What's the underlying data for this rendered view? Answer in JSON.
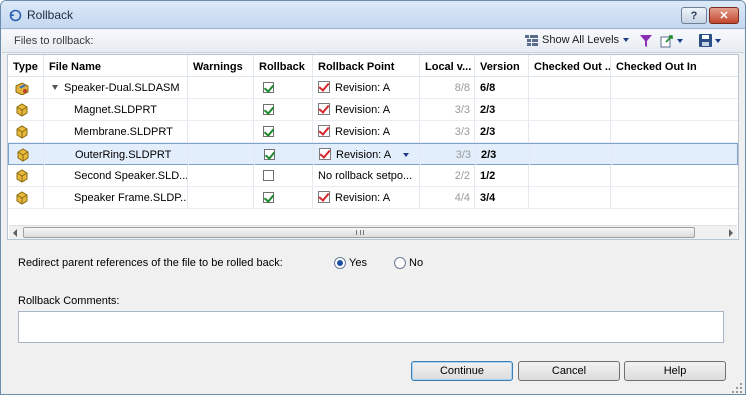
{
  "window": {
    "title": "Rollback",
    "help_label": "?",
    "close_label": "✕"
  },
  "toolbar": {
    "files_label": "Files to rollback:",
    "show_levels_label": "Show All Levels",
    "icons": [
      "filter-icon",
      "export-icon",
      "save-icon"
    ]
  },
  "grid": {
    "columns": [
      "Type",
      "File Name",
      "Warnings",
      "Rollback",
      "Rollback Point",
      "Local v...",
      "Version",
      "Checked Out ...",
      "Checked Out In"
    ],
    "rows": [
      {
        "name": "Speaker-Dual.SLDASM",
        "type": "assembly",
        "rollback": true,
        "rollback_point": "Revision: A",
        "has_revision": true,
        "local": "8/8",
        "version": "6/8",
        "expandable": true
      },
      {
        "name": "Magnet.SLDPRT",
        "type": "part",
        "rollback": true,
        "rollback_point": "Revision: A",
        "has_revision": true,
        "local": "3/3",
        "version": "2/3"
      },
      {
        "name": "Membrane.SLDPRT",
        "type": "part",
        "rollback": true,
        "rollback_point": "Revision: A",
        "has_revision": true,
        "local": "3/3",
        "version": "2/3"
      },
      {
        "name": "OuterRing.SLDPRT",
        "type": "part",
        "rollback": true,
        "rollback_point": "Revision: A",
        "has_revision": true,
        "local": "3/3",
        "version": "2/3",
        "selected": true
      },
      {
        "name": "Second Speaker.SLD...",
        "type": "part",
        "rollback": false,
        "rollback_point": "No rollback setpo...",
        "has_revision": false,
        "local": "2/2",
        "version": "1/2"
      },
      {
        "name": "Speaker Frame.SLDP...",
        "type": "part",
        "rollback": true,
        "rollback_point": "Revision: A",
        "has_revision": true,
        "local": "4/4",
        "version": "3/4"
      }
    ]
  },
  "redirect": {
    "label": "Redirect parent references of the file to be rolled back:",
    "yes": "Yes",
    "no": "No",
    "selected": "Yes"
  },
  "comments": {
    "label": "Rollback Comments:",
    "value": ""
  },
  "buttons": {
    "continue": "Continue",
    "cancel": "Cancel",
    "help": "Help"
  },
  "colors": {
    "selection": "#e3eefc",
    "accent": "#3c7fb1",
    "check_green": "#1d8a2e",
    "revision_red": "#d6252b"
  }
}
